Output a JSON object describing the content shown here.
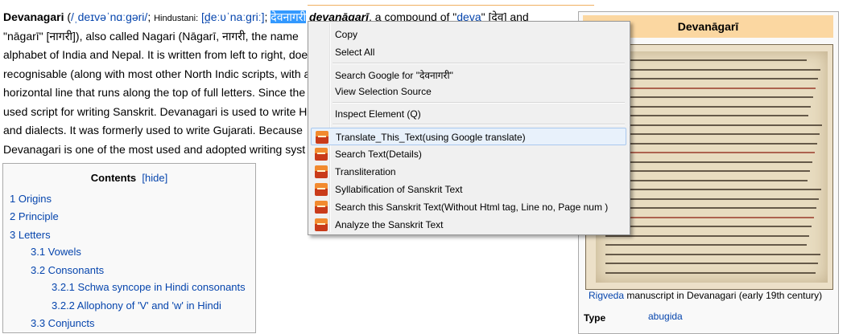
{
  "article": {
    "line1": {
      "title": "Devanagari",
      "paren_open": " (",
      "ipa1": "/ˌdeɪvəˈnɑːɡəri/",
      "sep1": "; ",
      "hindustani_label": "Hindustani:",
      "ipa2": "[d̪eːʋˈnaːɡriː]",
      "sep2": "; ",
      "selected": "देवनागरी",
      "translit": "devanāgarī",
      "rest": ", a compound of \"",
      "deva": "deva",
      "tail": "\" [देव] and"
    },
    "line2": "\"nāgarī\" [नागरी]), also called Nagari (Nāgarī, नागरी, the name",
    "line3": "alphabet of India and Nepal. It is written from left to right, doe",
    "line4": "recognisable (along with most other North Indic scripts, with a",
    "line5": "horizontal line that runs along the top of full letters. Since the",
    "line6": "used script for writing Sanskrit. Devanagari is used to write H",
    "line7": "and dialects. It was formerly used to write Gujarati. Because",
    "line8": "Devanagari is one of the most used and adopted writing syst"
  },
  "toc": {
    "title": "Contents",
    "hide": "[hide]",
    "items": [
      "1 Origins",
      "2 Principle",
      "3 Letters",
      "3.1 Vowels",
      "3.2 Consonants",
      "3.2.1 Schwa syncope in Hindi consonants",
      "3.2.2 Allophony of 'V' and 'w' in Hindi",
      "3.3 Conjuncts"
    ]
  },
  "infobox": {
    "title": "Devanāgarī",
    "caption_link": "Rigveda",
    "caption_rest": " manuscript in Devanagari (early 19th century)",
    "type_label": "Type",
    "type_value": "abugida"
  },
  "context_menu": {
    "items": [
      "Copy",
      "Select All",
      "Search Google for \"देवनागरी\"",
      "View Selection Source",
      "Inspect Element (Q)"
    ],
    "extension_items": [
      "Translate_This_Text(using Google translate)",
      "Search Text(Details)",
      "Transliteration",
      "Syllabification of Sanskrit Text",
      "Search this Sanskrit Text(Without Html tag, Line no, Page num )",
      "Analyze the Sanskrit Text"
    ],
    "highlighted_item": "Translate_This_Text(using Google translate)"
  },
  "colors": {
    "link": "#0645ad",
    "selection": "#3399ff",
    "infobox_header": "#fbd7a1",
    "menu_highlight": "#e8f1fb"
  }
}
